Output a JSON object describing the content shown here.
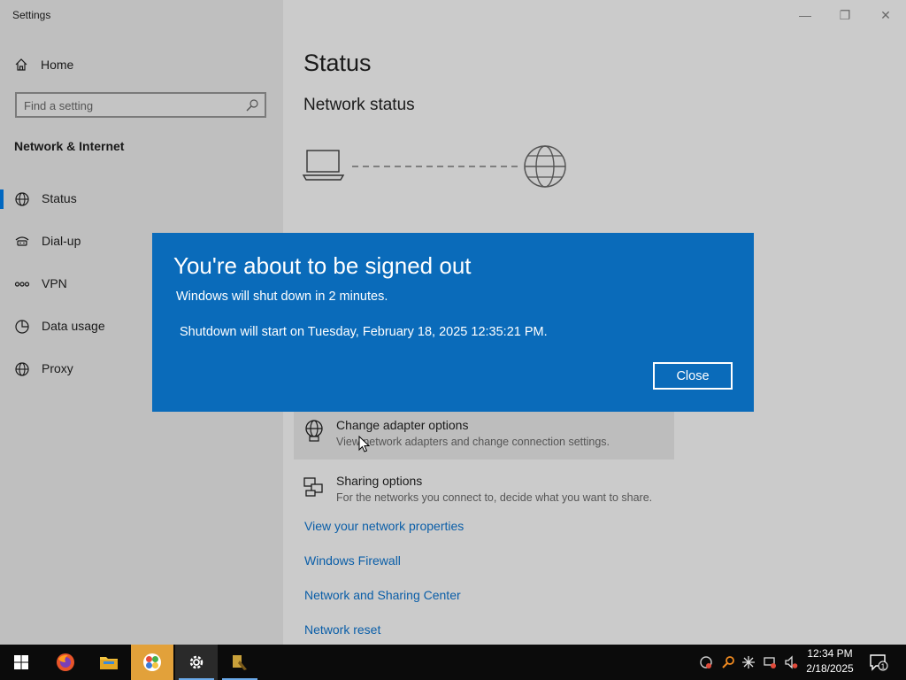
{
  "window": {
    "title": "Settings",
    "controls": {
      "minimize": "—",
      "restore": "❐",
      "close": "✕"
    }
  },
  "sidebar": {
    "home_label": "Home",
    "search_placeholder": "Find a setting",
    "section_title": "Network & Internet",
    "items": [
      {
        "label": "Status",
        "icon": "globe-icon",
        "selected": true
      },
      {
        "label": "Dial-up",
        "icon": "dialup-icon",
        "selected": false
      },
      {
        "label": "VPN",
        "icon": "vpn-icon",
        "selected": false
      },
      {
        "label": "Data usage",
        "icon": "data-usage-icon",
        "selected": false
      },
      {
        "label": "Proxy",
        "icon": "globe-icon",
        "selected": false
      }
    ]
  },
  "main": {
    "title": "Status",
    "subtitle": "Network status",
    "options": [
      {
        "title": "Change adapter options",
        "desc": "View network adapters and change connection settings.",
        "icon": "adapter-icon"
      },
      {
        "title": "Sharing options",
        "desc": "For the networks you connect to, decide what you want to share.",
        "icon": "sharing-icon"
      }
    ],
    "links": [
      "View your network properties",
      "Windows Firewall",
      "Network and Sharing Center",
      "Network reset"
    ]
  },
  "dialog": {
    "title": "You're about to be signed out",
    "line1": "Windows will shut down in 2 minutes.",
    "line2": "Shutdown will start on Tuesday, February 18, 2025 12:35:21 PM.",
    "close_label": "Close"
  },
  "taskbar": {
    "apps": [
      "start-icon",
      "firefox-icon",
      "file-explorer-icon",
      "app-icon",
      "settings-icon",
      "app-icon"
    ],
    "time": "12:34 PM",
    "date": "2/18/2025",
    "notification_count": "1"
  },
  "colors": {
    "accent": "#0a6bba",
    "link": "#0a5ea8",
    "selection": "#0067c0"
  }
}
